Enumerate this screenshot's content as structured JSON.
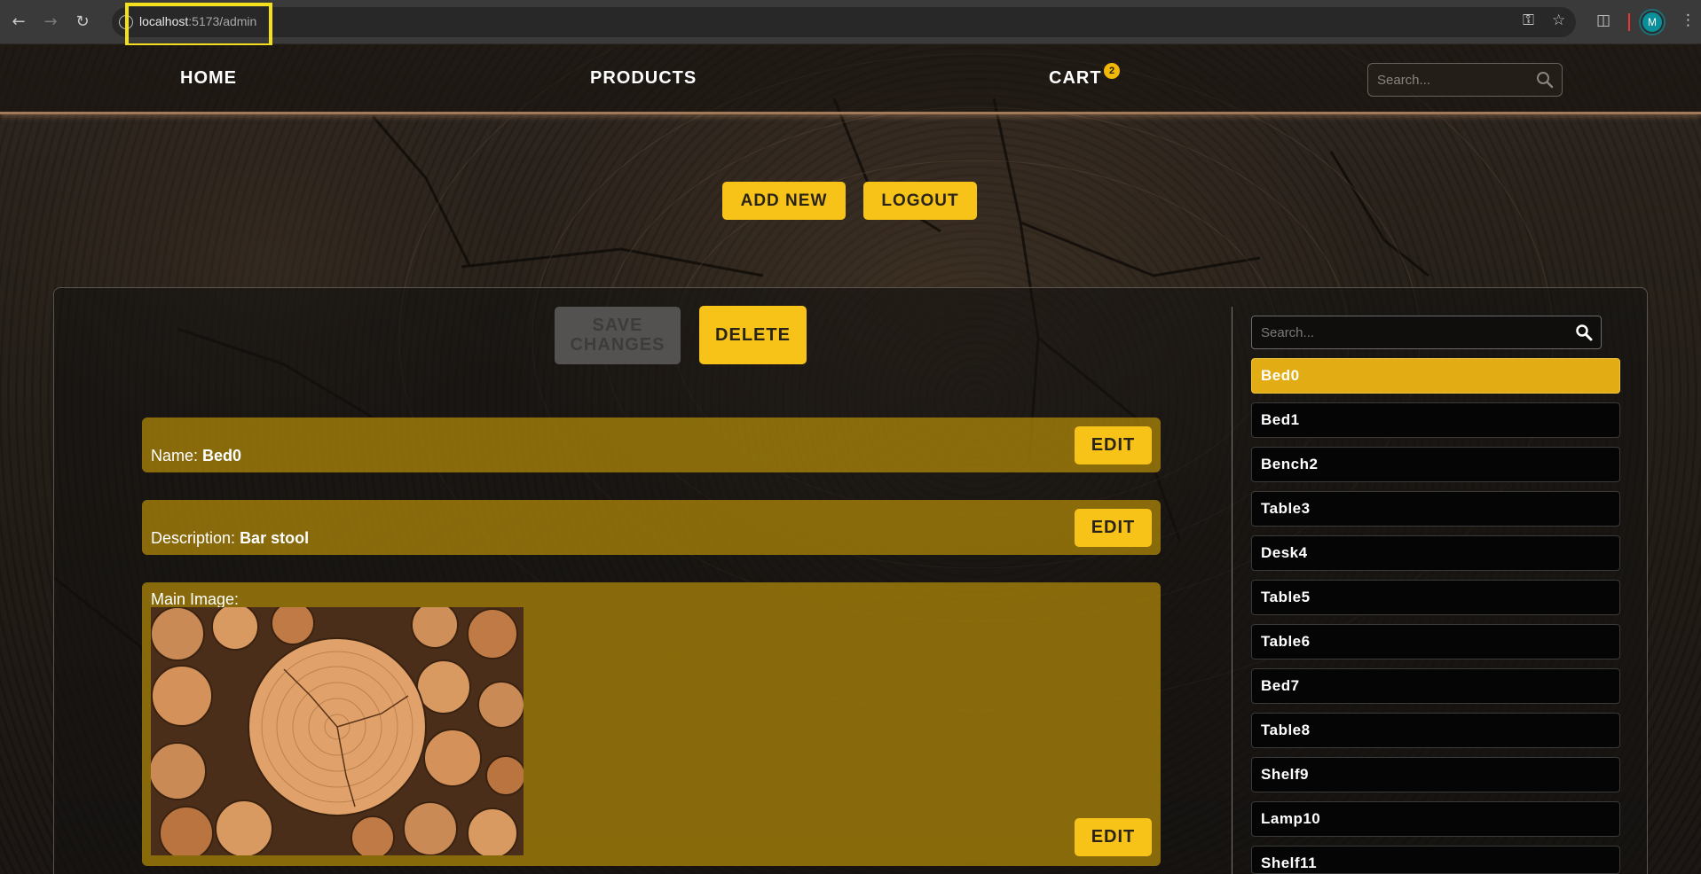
{
  "browser": {
    "url_host": "localhost",
    "url_path": ":5173/admin",
    "profile_initial": "M"
  },
  "header": {
    "nav": [
      "HOME",
      "PRODUCTS",
      "CART"
    ],
    "cart_count": "2",
    "search_placeholder": "Search..."
  },
  "actions": {
    "add_new": "ADD NEW",
    "logout": "LOGOUT"
  },
  "editor": {
    "save_label": "SAVE CHANGES",
    "save_enabled": false,
    "delete_label": "DELETE",
    "edit_label": "EDIT",
    "fields": {
      "name_label": "Name:",
      "name_value": "Bed0",
      "description_label": "Description:",
      "description_value": "Bar stool",
      "main_image_label": "Main Image:"
    }
  },
  "sidebar": {
    "search_placeholder": "Search...",
    "selected": "Bed0",
    "products": [
      "Bed0",
      "Bed1",
      "Bench2",
      "Table3",
      "Desk4",
      "Table5",
      "Table6",
      "Bed7",
      "Table8",
      "Shelf9",
      "Lamp10",
      "Shelf11"
    ]
  },
  "colors": {
    "accent": "#f7c319",
    "field_bg": "#b48c0a",
    "active_item": "#e2ad14"
  }
}
